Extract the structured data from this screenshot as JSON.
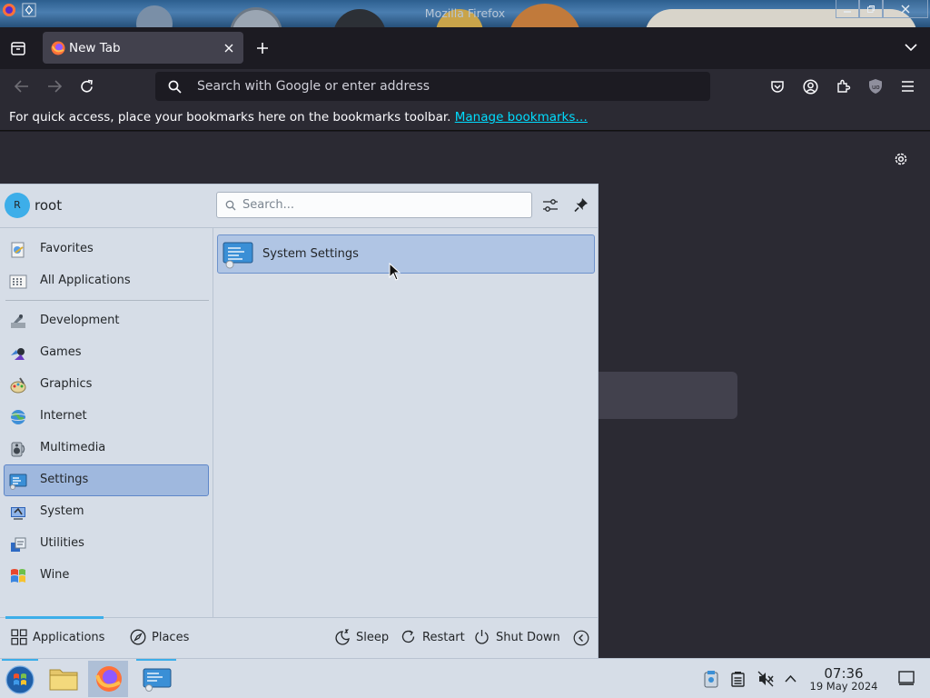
{
  "window": {
    "title": "Mozilla Firefox"
  },
  "browser": {
    "tab": {
      "title": "New Tab"
    },
    "url_placeholder": "Search with Google or enter address",
    "bookmarks_bar": {
      "message": "For quick access, place your bookmarks here on the bookmarks toolbar.",
      "link": "Manage bookmarks…"
    }
  },
  "launcher": {
    "user": {
      "initial": "R",
      "name": "root"
    },
    "search_placeholder": "Search...",
    "categories": [
      {
        "label": "Favorites",
        "icon": "favorites-icon"
      },
      {
        "label": "All Applications",
        "icon": "all-applications-icon"
      },
      {
        "label": "Development",
        "icon": "development-icon"
      },
      {
        "label": "Games",
        "icon": "games-icon"
      },
      {
        "label": "Graphics",
        "icon": "graphics-icon"
      },
      {
        "label": "Internet",
        "icon": "internet-icon"
      },
      {
        "label": "Multimedia",
        "icon": "multimedia-icon"
      },
      {
        "label": "Settings",
        "icon": "settings-icon",
        "selected": true
      },
      {
        "label": "System",
        "icon": "system-icon"
      },
      {
        "label": "Utilities",
        "icon": "utilities-icon"
      },
      {
        "label": "Wine",
        "icon": "wine-icon"
      }
    ],
    "results": [
      {
        "label": "System Settings",
        "icon": "system-settings-icon"
      }
    ],
    "footer": {
      "applications": "Applications",
      "places": "Places",
      "sleep": "Sleep",
      "restart": "Restart",
      "shutdown": "Shut Down"
    }
  },
  "taskbar": {
    "clock": {
      "time": "07:36",
      "date": "19 May 2024"
    }
  },
  "colors": {
    "launcher_bg": "#d6dde7",
    "selection": "#9fb8de",
    "accent": "#3daee9",
    "browser_bg": "#2b2a33",
    "link": "#00ddff"
  }
}
